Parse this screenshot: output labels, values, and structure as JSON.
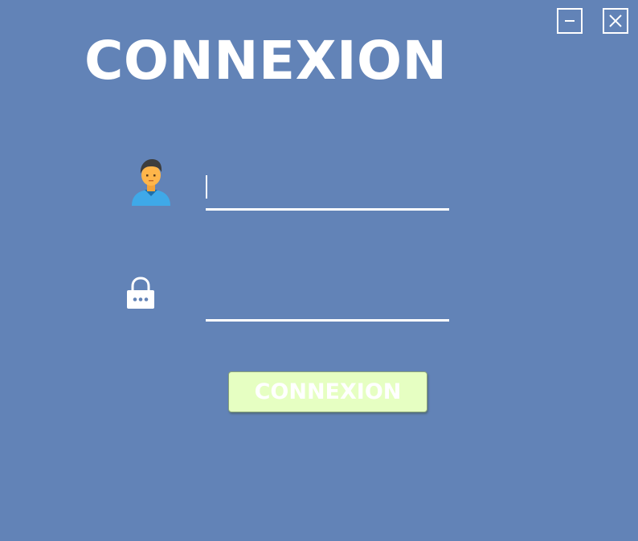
{
  "window_controls": {
    "minimize_icon": "minimize-icon",
    "close_icon": "close-icon"
  },
  "header": {
    "title": "CONNEXION"
  },
  "form": {
    "username": {
      "icon": "user-icon",
      "value": "",
      "placeholder": ""
    },
    "password": {
      "icon": "lock-icon",
      "value": "",
      "placeholder": ""
    },
    "submit_label": "CONNEXION"
  },
  "colors": {
    "background": "#6283b7",
    "text": "#ffffff",
    "button_background": "#e6ffc2"
  }
}
